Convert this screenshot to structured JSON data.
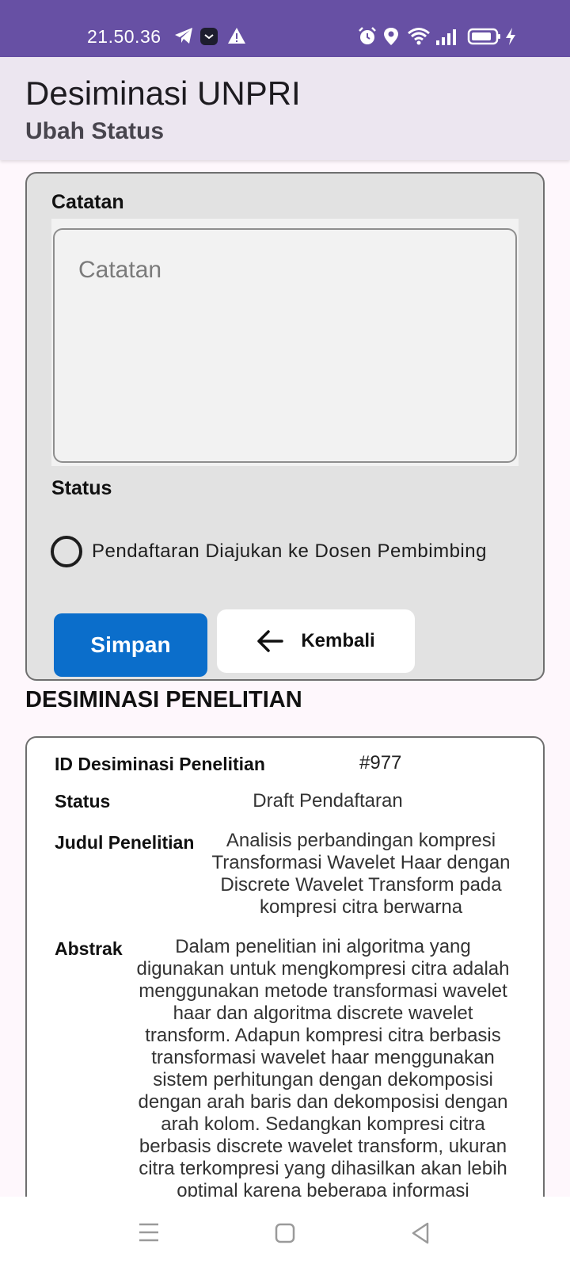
{
  "status_bar": {
    "time": "21.50.36"
  },
  "app_bar": {
    "title": "Desiminasi UNPRI",
    "subtitle": "Ubah Status"
  },
  "form": {
    "catatan_label": "Catatan",
    "catatan_placeholder": "Catatan",
    "catatan_value": "",
    "status_label": "Status",
    "status_options": [
      "Pendaftaran Diajukan ke Dosen Pembimbing"
    ],
    "save_label": "Simpan",
    "back_label": "Kembali"
  },
  "detail": {
    "section_title": "DESIMINASI PENELITIAN",
    "id_label": "ID Desiminasi Penelitian",
    "id_value": "#977",
    "status_label": "Status",
    "status_value": "Draft Pendaftaran",
    "judul_label": "Judul Penelitian",
    "judul_value": "Analisis perbandingan kompresi Transformasi Wavelet Haar dengan Discrete Wavelet Transform pada kompresi citra berwarna",
    "abstrak_label": "Abstrak",
    "abstrak_value": "Dalam penelitian ini algoritma yang digunakan untuk mengkompresi citra adalah menggunakan metode transformasi wavelet haar dan algoritma discrete wavelet transform. Adapun kompresi citra berbasis transformasi wavelet haar menggunakan sistem perhitungan dengan dekomposisi dengan arah baris dan dekomposisi dengan arah kolom. Sedangkan kompresi citra berbasis discrete wavelet transform, ukuran citra terkompresi yang dihasilkan akan lebih optimal karena beberapa informasi"
  },
  "icons": {
    "status_bar": [
      "telegram-icon",
      "clock-app-icon",
      "warning-icon",
      "alarm-icon",
      "location-icon",
      "wifi-icon",
      "signal-icon",
      "battery-icon",
      "charging-icon"
    ],
    "back": "arrow-left-icon",
    "nav": [
      "menu-icon",
      "home-icon",
      "back-icon"
    ]
  },
  "colors": {
    "status_bar": "#6750a4",
    "app_bar": "#ece6f0",
    "primary_button": "#0b6ecb"
  }
}
